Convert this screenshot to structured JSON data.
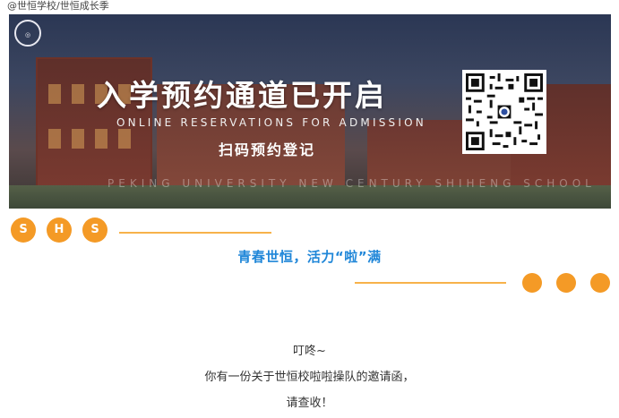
{
  "caption": "@世恒学校/世恒成长季",
  "banner": {
    "title": "入学预约通道已开启",
    "subtitle_en": "ONLINE RESERVATIONS FOR ADMISSION",
    "scan_text": "扫码预约登记",
    "watermark": "PEKING UNIVERSITY NEW CENTURY SHIHENG SCHOOL"
  },
  "badges": [
    "S",
    "H",
    "S"
  ],
  "slogan": "青春世恒，活力“啦”满",
  "colors": {
    "accent_orange": "#f49a26",
    "line_orange": "#f7b24a",
    "slogan_blue": "#1f86d8"
  },
  "body": {
    "line1": "叮咚~",
    "line2": "你有一份关于世恒校啦啦操队的邀请函，",
    "line3": "请查收！"
  }
}
